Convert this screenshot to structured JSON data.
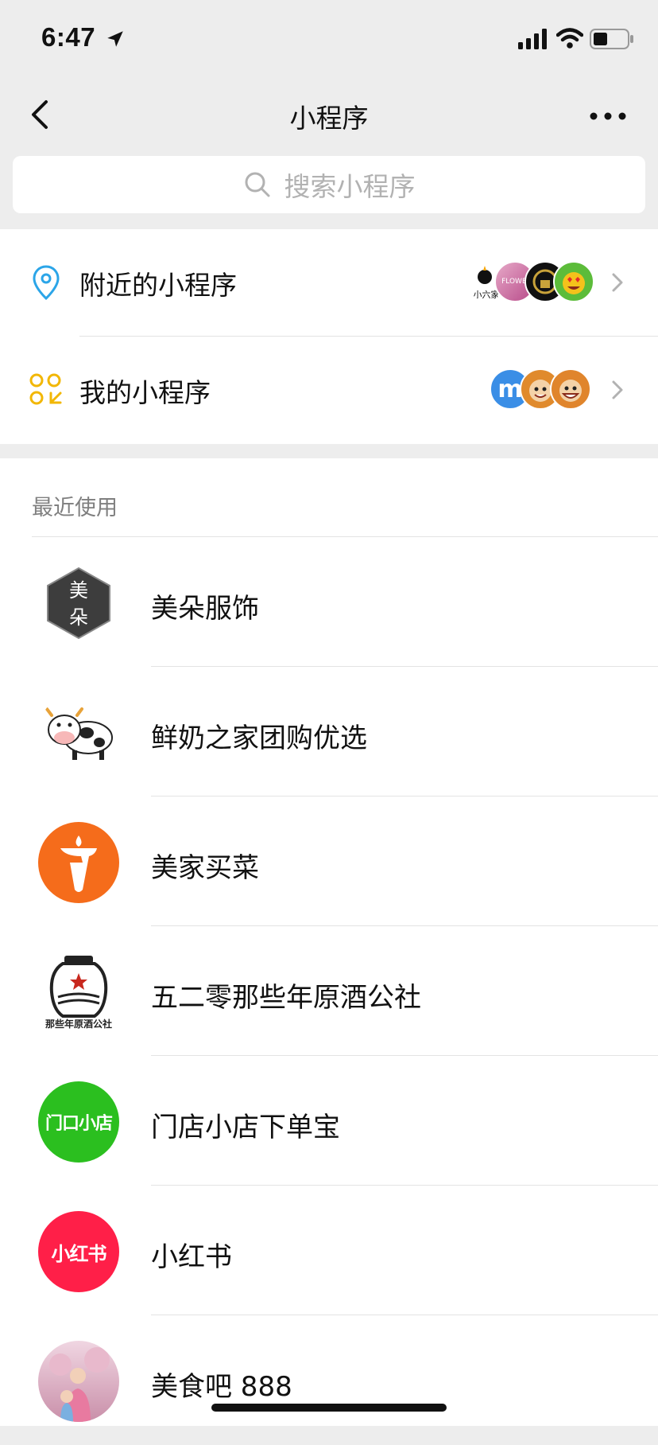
{
  "status_bar": {
    "time": "6:47",
    "icons": [
      "location-arrow-icon",
      "cellular-signal-icon",
      "wifi-icon",
      "battery-icon"
    ]
  },
  "nav": {
    "title": "小程序",
    "back_icon": "chevron-left-icon",
    "more_icon": "more-dots-icon"
  },
  "search": {
    "placeholder": "搜索小程序",
    "icon": "search-icon"
  },
  "entries": [
    {
      "label": "附近的小程序",
      "icon": "location-pin-icon",
      "icon_color": "#2ba5e8",
      "thumb_text": [
        "小六家",
        "FLOWER"
      ]
    },
    {
      "label": "我的小程序",
      "icon": "mini-program-grid-icon",
      "icon_color": "#f2b705",
      "thumb_text": [
        "m"
      ]
    }
  ],
  "recent": {
    "title": "最近使用",
    "apps": [
      {
        "name": "美朵服饰",
        "logo_text": [
          "美",
          "朵"
        ],
        "logo_bg": "#3d3d3d"
      },
      {
        "name": "鲜奶之家团购优选",
        "logo": "cow-icon"
      },
      {
        "name": "美家买菜",
        "logo": "carrot-icon",
        "logo_bg": "#f56c1b"
      },
      {
        "name": "五二零那些年原酒公社",
        "logo_text": [
          "那些年原酒公社"
        ],
        "logo": "wine-jar-icon"
      },
      {
        "name": "门店小店下单宝",
        "logo_text": [
          "门口小店"
        ],
        "logo_bg": "#2bbf1f"
      },
      {
        "name": "小红书",
        "logo_text": [
          "小红书"
        ],
        "logo_bg": "#ff1f48"
      },
      {
        "name": "美食吧 888",
        "logo": "photo-avatar-icon"
      }
    ]
  },
  "colors": {
    "accent_blue": "#2ba5e8",
    "accent_yellow": "#f2b705",
    "background": "#ededed"
  }
}
